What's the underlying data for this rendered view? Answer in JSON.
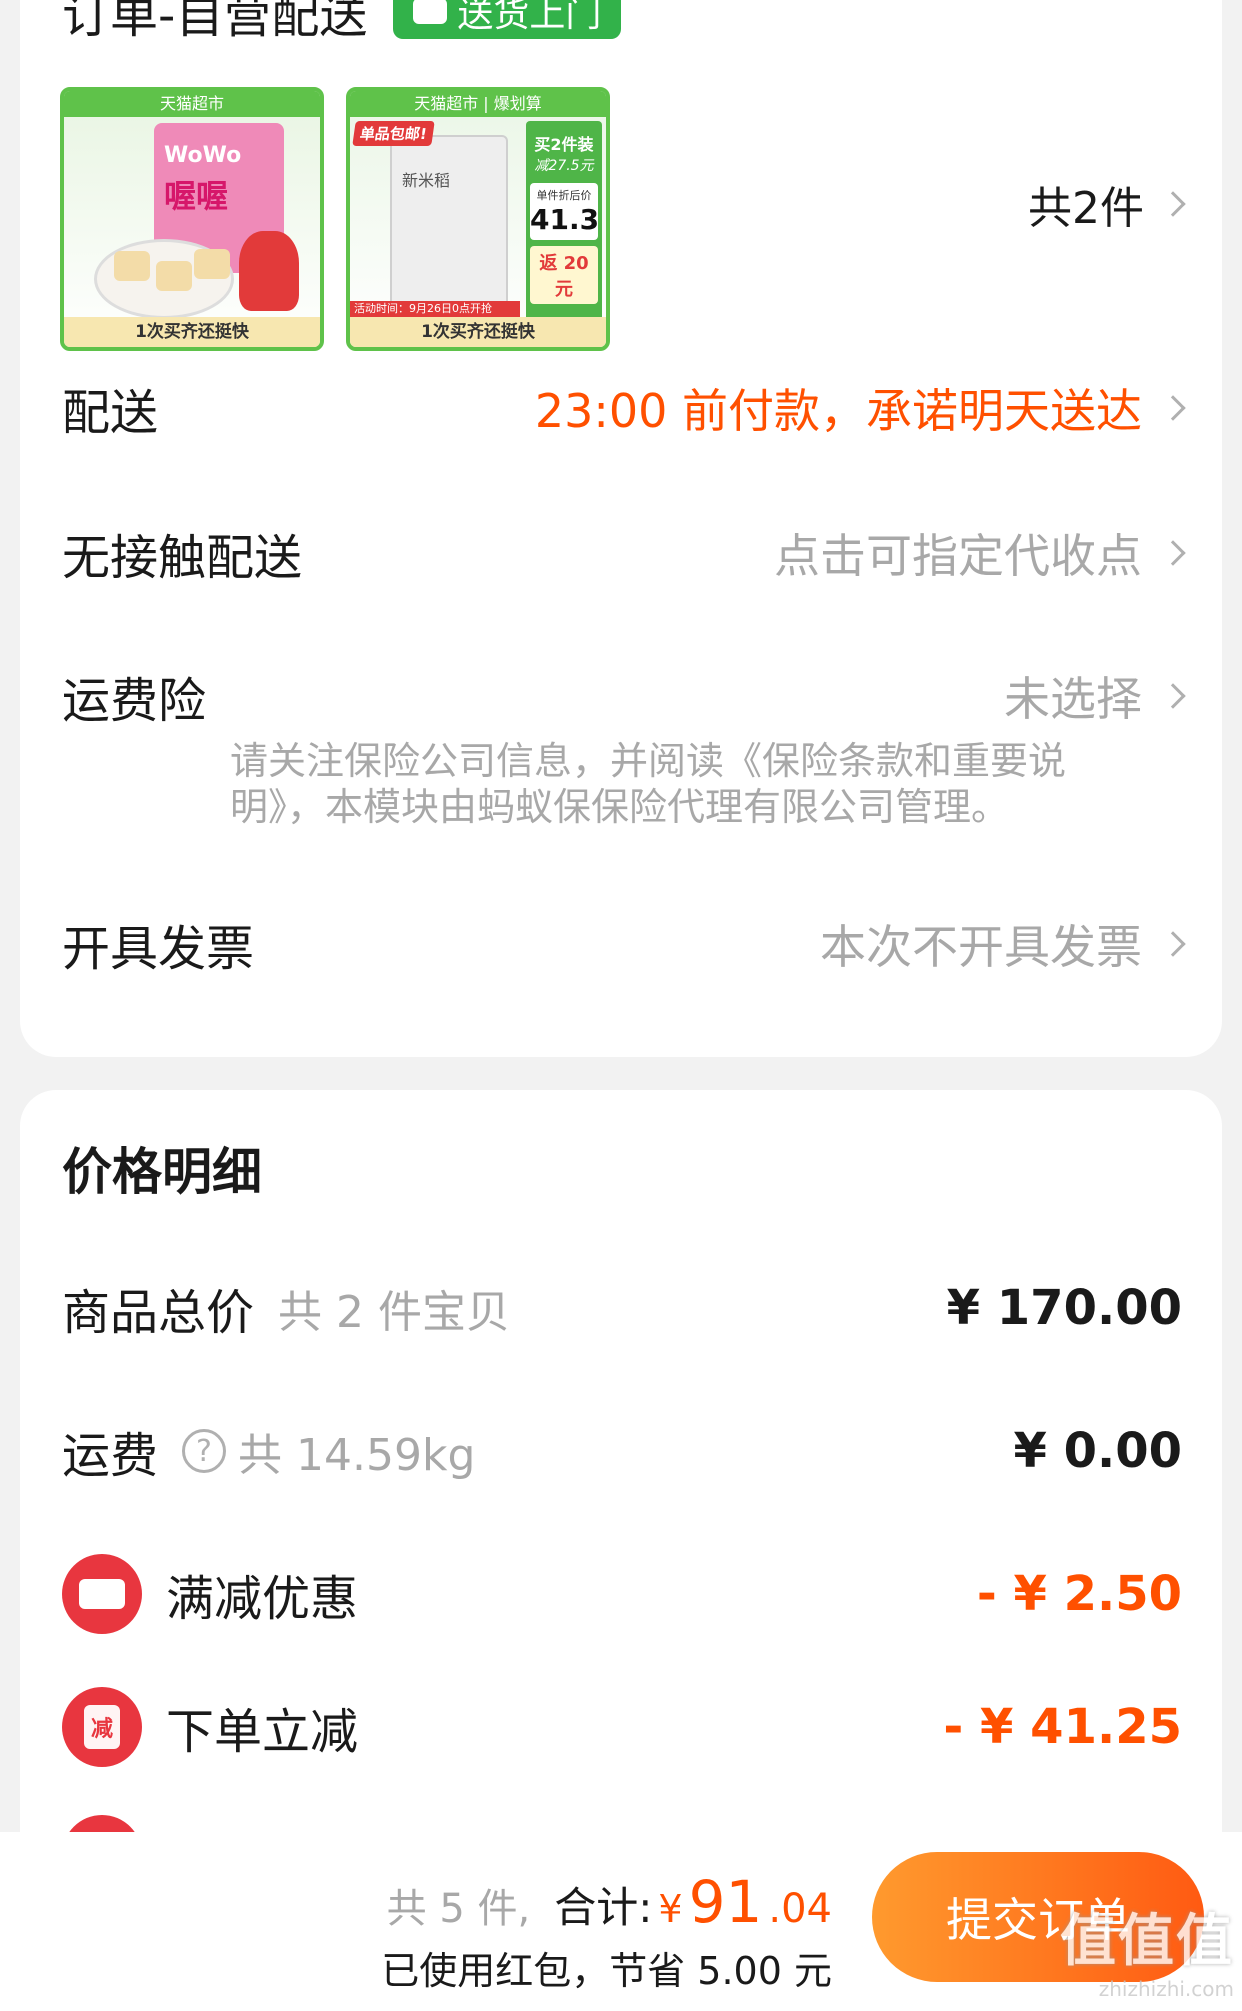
{
  "order_section": {
    "title": "订单-自营配送",
    "tag": "送货上门",
    "items": [
      {
        "top_label": "天猫超市",
        "brand": "WoWo",
        "product_name": "喔喔",
        "bottom_label": "1次买齐还挺快"
      },
      {
        "top_label": "天猫超市 | 爆划算",
        "badge": "单品包邮!",
        "product_name": "新米稻",
        "promo_line1": "买2件装",
        "promo_line2": "减27.5元",
        "unit_label": "单件折后价",
        "unit_price": "41.3",
        "rebate": "返 20 元",
        "campaign_strip": "活动时间：9月26日0点开抢",
        "bottom_label": "1次买齐还挺快"
      }
    ],
    "item_count": "共2件"
  },
  "rows": {
    "delivery": {
      "label": "配送",
      "value": "23:00 前付款，承诺明天送达"
    },
    "contactless": {
      "label": "无接触配送",
      "value": "点击可指定代收点"
    },
    "insurance": {
      "label": "运费险",
      "value": "未选择",
      "note": "请关注保险公司信息，并阅读《保险条款和重要说明》，本模块由蚂蚁保保险代理有限公司管理。"
    },
    "invoice": {
      "label": "开具发票",
      "value": "本次不开具发票"
    }
  },
  "price_detail": {
    "title": "价格明细",
    "goods_total": {
      "label": "商品总价",
      "sub": "共 2 件宝贝",
      "amount": "¥ 170.00"
    },
    "shipping": {
      "label": "运费",
      "sub": "共 14.59kg",
      "amount": "¥ 0.00"
    },
    "full_discount": {
      "label": "满减优惠",
      "amount": "- ¥ 2.50"
    },
    "instant_discount": {
      "label": "下单立减",
      "icon_text": "减",
      "amount": "- ¥ 41.25"
    }
  },
  "bottom_bar": {
    "count": "共 5 件,",
    "total_label": "合计:",
    "currency": "¥",
    "total_int": "91",
    "total_dec": ".04",
    "savings": "已使用红包，节省 5.00 元",
    "submit_label": "提交订单"
  },
  "watermark": {
    "logo": "值值值",
    "site": "zhizhizhi.com"
  },
  "colors": {
    "accent_orange": "#ff5000",
    "tmall_green": "#5fc24a",
    "discount_red": "#e8363f",
    "muted_gray": "#a8a8a8"
  }
}
